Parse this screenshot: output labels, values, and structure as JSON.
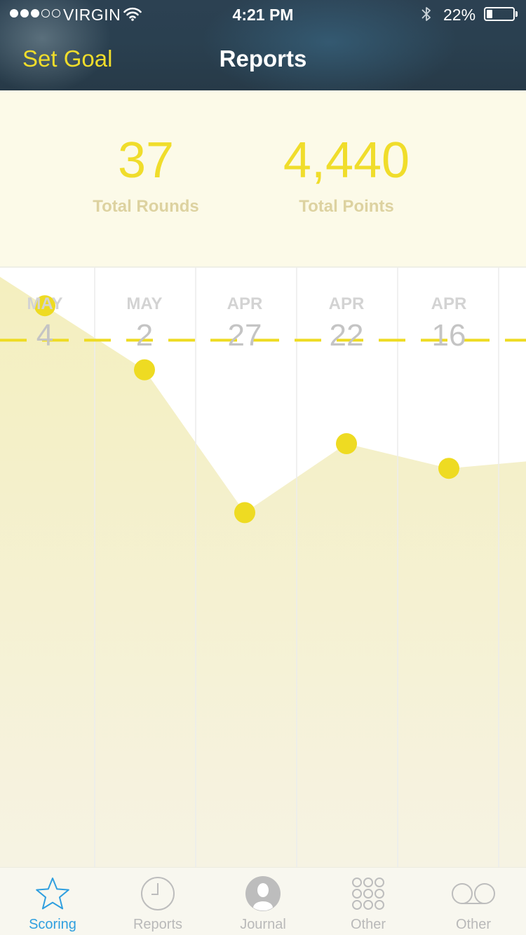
{
  "status_bar": {
    "carrier": "VIRGIN",
    "time": "4:21 PM",
    "battery": "22%",
    "battery_level": 0.22
  },
  "nav": {
    "left_button": "Set Goal",
    "title": "Reports"
  },
  "summary": {
    "rounds_value": "37",
    "rounds_label": "Total Rounds",
    "points_value": "4,440",
    "points_label": "Total Points"
  },
  "chart_data": {
    "type": "area",
    "x": [
      {
        "month": "MAY",
        "day": "4"
      },
      {
        "month": "MAY",
        "day": "2"
      },
      {
        "month": "APR",
        "day": "27"
      },
      {
        "month": "APR",
        "day": "22"
      },
      {
        "month": "APR",
        "day": "16"
      }
    ],
    "values": [
      94,
      81,
      52,
      66,
      61
    ],
    "goal": 87,
    "ylim": [
      0,
      100
    ],
    "colors": {
      "fill": "#f3eebb",
      "point": "#eedb22",
      "goal_line": "#eedb22",
      "column_line": "#ececec"
    }
  },
  "tabbar": {
    "accent_color": "#2f9fdf",
    "items": [
      {
        "label": "Scoring",
        "icon": "star-icon",
        "active": true
      },
      {
        "label": "Reports",
        "icon": "clock-icon",
        "active": false
      },
      {
        "label": "Journal",
        "icon": "person-icon",
        "active": false
      },
      {
        "label": "Other",
        "icon": "grid-icon",
        "active": false
      },
      {
        "label": "Other",
        "icon": "voicemail-icon",
        "active": false
      }
    ]
  }
}
